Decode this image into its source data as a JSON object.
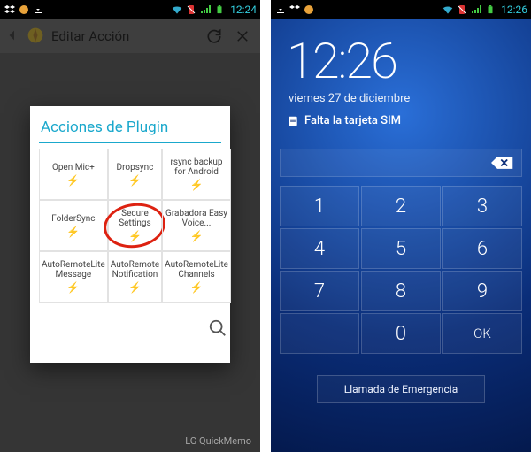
{
  "left": {
    "statusbar": {
      "time": "12:24"
    },
    "header": {
      "title": "Editar Acción"
    },
    "popup": {
      "title": "Acciones de Plugin",
      "items": [
        "Open Mic+",
        "Dropsync",
        "rsync backup for Android",
        "FolderSync",
        "Secure Settings",
        "Grabadora Easy Voice...",
        "AutoRemoteLite Message",
        "AutoRemote Notification",
        "AutoRemoteLite Channels"
      ]
    },
    "watermark": "LG QuickMemo"
  },
  "right": {
    "statusbar": {
      "time": "12:26"
    },
    "lock": {
      "time": "12:26",
      "date": "viernes 27 de diciembre",
      "sim_msg": "Falta la tarjeta SIM"
    },
    "keypad": {
      "keys": [
        "1",
        "2",
        "3",
        "4",
        "5",
        "6",
        "7",
        "8",
        "9",
        "",
        "0",
        "OK"
      ]
    },
    "emergency": "Llamada de Emergencia"
  }
}
